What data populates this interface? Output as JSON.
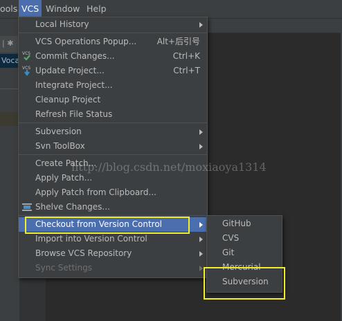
{
  "menubar": {
    "items": [
      {
        "label": "ools"
      },
      {
        "label": "VCS"
      },
      {
        "label": "Window"
      },
      {
        "label": "Help"
      }
    ]
  },
  "left_panel": {
    "toolbar_glyphs": "| ✱",
    "tab_label": "Voca"
  },
  "vcs_menu": {
    "items": [
      {
        "label": "Local History",
        "submenu": true
      },
      {
        "label": "VCS Operations Popup...",
        "shortcut": "Alt+后引号"
      },
      {
        "label": "Commit Changes...",
        "shortcut": "Ctrl+K",
        "icon": "commit-icon"
      },
      {
        "label": "Update Project...",
        "shortcut": "Ctrl+T",
        "icon": "update-icon"
      },
      {
        "label": "Integrate Project..."
      },
      {
        "label": "Cleanup Project"
      },
      {
        "label": "Refresh File Status"
      },
      {
        "label": "Subversion",
        "submenu": true
      },
      {
        "label": "Svn ToolBox",
        "submenu": true
      },
      {
        "label": "Create Patch..."
      },
      {
        "label": "Apply Patch..."
      },
      {
        "label": "Apply Patch from Clipboard..."
      },
      {
        "label": "Shelve Changes...",
        "icon": "shelve-icon"
      },
      {
        "label": "Checkout from Version Control",
        "submenu": true,
        "selected": true
      },
      {
        "label": "Import into Version Control",
        "submenu": true
      },
      {
        "label": "Browse VCS Repository",
        "submenu": true
      },
      {
        "label": "Sync Settings",
        "submenu": true,
        "disabled": true
      }
    ]
  },
  "checkout_submenu": {
    "items": [
      {
        "label": "GitHub"
      },
      {
        "label": "CVS"
      },
      {
        "label": "Git"
      },
      {
        "label": "Mercurial"
      },
      {
        "label": "Subversion"
      }
    ]
  },
  "icons": {
    "vcs_badge_text": "VCS"
  },
  "colors": {
    "selection": "#4b6eaf",
    "highlight_box": "#f4ee2a",
    "menu_bg": "#3c3f41"
  },
  "watermark": "http://blog.csdn.net/moxiaoya1314"
}
